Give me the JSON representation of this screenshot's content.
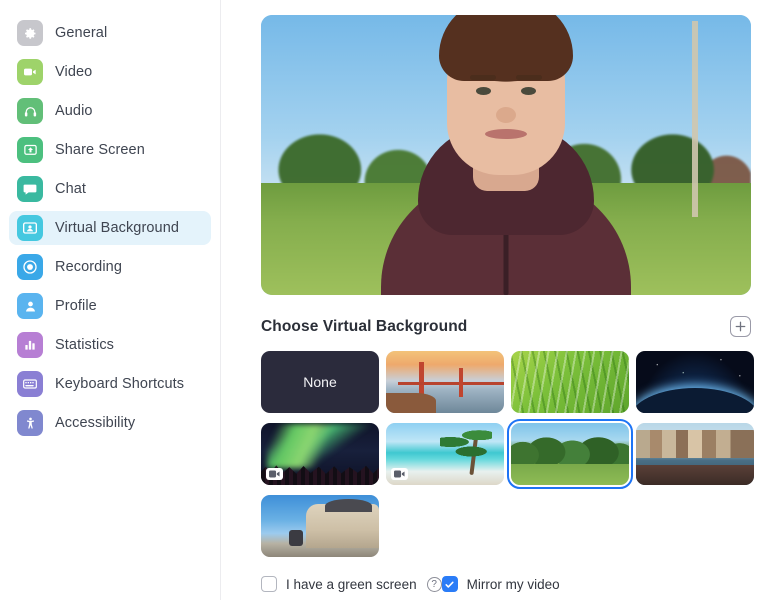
{
  "sidebar": {
    "items": [
      {
        "label": "General",
        "icon": "gear-icon",
        "color": "#c7c7cc",
        "active": false
      },
      {
        "label": "Video",
        "icon": "video-camera-icon",
        "color": "#9ed36a",
        "active": false
      },
      {
        "label": "Audio",
        "icon": "headphones-icon",
        "color": "#62bf78",
        "active": false
      },
      {
        "label": "Share Screen",
        "icon": "share-screen-icon",
        "color": "#4cc07f",
        "active": false
      },
      {
        "label": "Chat",
        "icon": "chat-bubble-icon",
        "color": "#3ab9a0",
        "active": false
      },
      {
        "label": "Virtual Background",
        "icon": "virtual-background-icon",
        "color": "#45c8e0",
        "active": true
      },
      {
        "label": "Recording",
        "icon": "record-icon",
        "color": "#3aa8e8",
        "active": false
      },
      {
        "label": "Profile",
        "icon": "person-icon",
        "color": "#5ab4ef",
        "active": false
      },
      {
        "label": "Statistics",
        "icon": "bar-chart-icon",
        "color": "#b77fd4",
        "active": false
      },
      {
        "label": "Keyboard Shortcuts",
        "icon": "keyboard-icon",
        "color": "#8a7fd4",
        "active": false
      },
      {
        "label": "Accessibility",
        "icon": "accessibility-icon",
        "color": "#8088cf",
        "active": false
      }
    ]
  },
  "preview": {
    "alt": "video-preview-with-virtual-background"
  },
  "section": {
    "title": "Choose Virtual Background",
    "add_button_label": "+"
  },
  "backgrounds": [
    {
      "name": "none",
      "label": "None",
      "scene": "none",
      "video": false,
      "selected": false
    },
    {
      "name": "golden-gate",
      "label": "",
      "scene": "bridge",
      "video": false,
      "selected": false
    },
    {
      "name": "grass",
      "label": "",
      "scene": "grass2",
      "video": false,
      "selected": false
    },
    {
      "name": "earth-space",
      "label": "",
      "scene": "space",
      "video": false,
      "selected": false
    },
    {
      "name": "aurora",
      "label": "",
      "scene": "aurora",
      "video": true,
      "selected": false
    },
    {
      "name": "beach",
      "label": "",
      "scene": "beach",
      "video": true,
      "selected": false
    },
    {
      "name": "park",
      "label": "",
      "scene": "park",
      "video": false,
      "selected": true
    },
    {
      "name": "harbor",
      "label": "",
      "scene": "harbor",
      "video": false,
      "selected": false
    },
    {
      "name": "palace",
      "label": "",
      "scene": "palace",
      "video": false,
      "selected": false
    }
  ],
  "options": {
    "green_screen": {
      "label": "I have a green screen",
      "checked": false,
      "help": "?"
    },
    "mirror_video": {
      "label": "Mirror my video",
      "checked": true
    }
  },
  "colors": {
    "accent": "#2a7cf7",
    "selection_ring": "#1d74f5",
    "sidebar_active_bg": "#e4f3fb",
    "text": "#3f4551"
  }
}
